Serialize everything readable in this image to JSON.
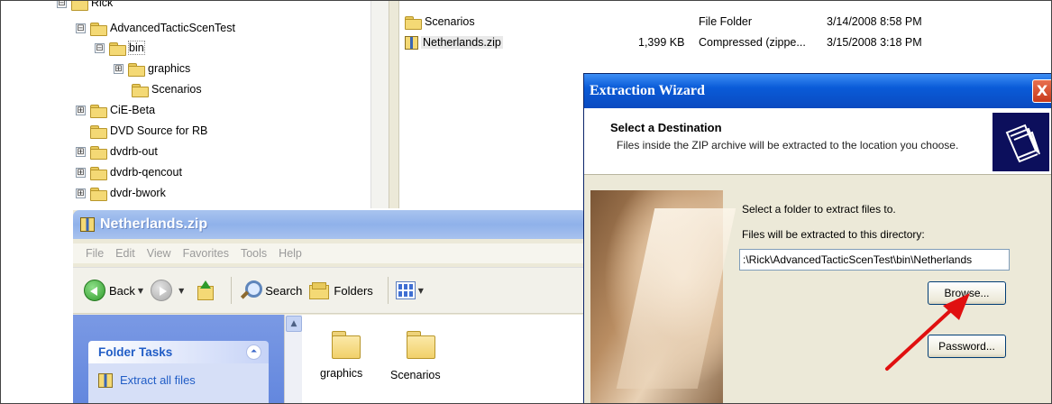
{
  "tree": {
    "items": [
      {
        "label": "Rick",
        "expander": "⊟"
      },
      {
        "label": "AdvancedTacticScenTest",
        "expander": "⊟"
      },
      {
        "label": "bin",
        "expander": "⊟"
      },
      {
        "label": "graphics",
        "expander": "⊞"
      },
      {
        "label": "Scenarios",
        "expander": ""
      },
      {
        "label": "CiE-Beta",
        "expander": "⊞"
      },
      {
        "label": "DVD Source for RB",
        "expander": ""
      },
      {
        "label": "dvdrb-out",
        "expander": "⊞"
      },
      {
        "label": "dvdrb-qencout",
        "expander": "⊞"
      },
      {
        "label": "dvdr-bwork",
        "expander": "⊞"
      }
    ]
  },
  "files": [
    {
      "name": "Scenarios",
      "size": "",
      "type": "File Folder",
      "modified": "3/14/2008 8:58 PM"
    },
    {
      "name": "Netherlands.zip",
      "size": "1,399 KB",
      "type": "Compressed (zippe...",
      "modified": "3/15/2008 3:18 PM"
    }
  ],
  "explorer": {
    "title": "Netherlands.zip",
    "menu": [
      "File",
      "Edit",
      "View",
      "Favorites",
      "Tools",
      "Help"
    ],
    "toolbar": {
      "back_label": "Back",
      "search_label": "Search",
      "folders_label": "Folders"
    },
    "tasks": {
      "header": "Folder Tasks",
      "link": "Extract all files"
    },
    "content_items": [
      "graphics",
      "Scenarios"
    ]
  },
  "wizard": {
    "title": "Extraction Wizard",
    "close_label": "X",
    "heading": "Select a Destination",
    "description": "Files inside the ZIP archive will be extracted to the location you choose.",
    "select_label": "Select a folder to extract files to.",
    "dir_label": "Files will be extracted to this directory:",
    "destination": ":\\Rick\\AdvancedTacticScenTest\\bin\\Netherlands",
    "browse_label": "Browse...",
    "password_label": "Password..."
  },
  "colors": {
    "annotation_arrow": "#e01010",
    "wizard_title": "#0a4ac0",
    "task_link": "#215dc6"
  }
}
